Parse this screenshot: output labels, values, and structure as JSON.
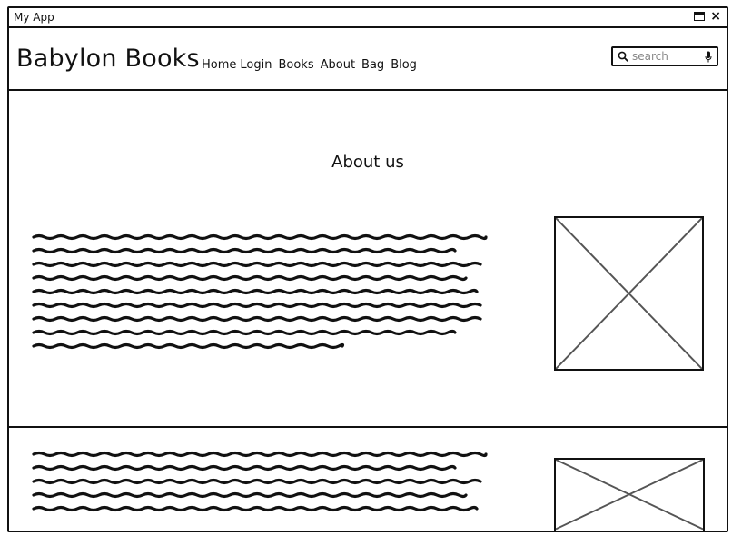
{
  "window": {
    "title": "My App",
    "close_glyph": "×"
  },
  "header": {
    "brand": "Babylon Books",
    "nav": [
      "Home",
      "Login",
      "Books",
      "About",
      "Bag",
      "Blog"
    ],
    "search": {
      "placeholder": "search",
      "value": ""
    }
  },
  "about": {
    "title": "About us"
  },
  "icons": [
    "maximize-icon",
    "close-icon",
    "search-icon",
    "mic-icon",
    "image-placeholder-icon"
  ]
}
